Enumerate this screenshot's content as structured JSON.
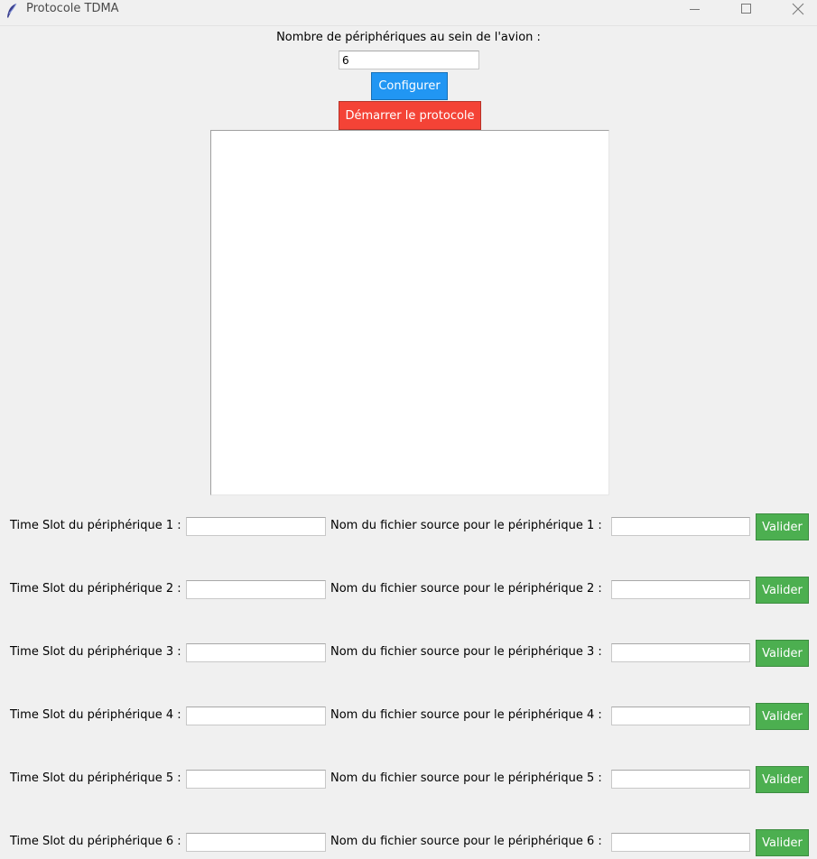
{
  "window": {
    "title": "Protocole TDMA",
    "min_icon": "minimize-icon",
    "max_icon": "maximize-icon",
    "close_symbol": "✕"
  },
  "config": {
    "prompt": "Nombre de périphériques au sein de l'avion :",
    "count_value": "6",
    "configure_label": "Configurer",
    "start_label": "Démarrer le protocole"
  },
  "devices": [
    {
      "timeslot_label": "Time Slot du périphérique 1 :",
      "source_label": "Nom du fichier source pour le périphérique 1 :",
      "button": "Valider",
      "timeslot_value": "",
      "source_value": ""
    },
    {
      "timeslot_label": "Time Slot du périphérique 2 :",
      "source_label": "Nom du fichier source pour le périphérique 2 :",
      "button": "Valider",
      "timeslot_value": "",
      "source_value": ""
    },
    {
      "timeslot_label": "Time Slot du périphérique 3 :",
      "source_label": "Nom du fichier source pour le périphérique 3 :",
      "button": "Valider",
      "timeslot_value": "",
      "source_value": ""
    },
    {
      "timeslot_label": "Time Slot du périphérique 4 :",
      "source_label": "Nom du fichier source pour le périphérique 4 :",
      "button": "Valider",
      "timeslot_value": "",
      "source_value": ""
    },
    {
      "timeslot_label": "Time Slot du périphérique 5 :",
      "source_label": "Nom du fichier source pour le périphérique 5 :",
      "button": "Valider",
      "timeslot_value": "",
      "source_value": ""
    },
    {
      "timeslot_label": "Time Slot du périphérique 6 :",
      "source_label": "Nom du fichier source pour le périphérique 6 :",
      "button": "Valider",
      "timeslot_value": "",
      "source_value": ""
    }
  ],
  "colors": {
    "configure_button": "#2196f3",
    "start_button": "#f44336",
    "valider_button": "#4caf50"
  }
}
